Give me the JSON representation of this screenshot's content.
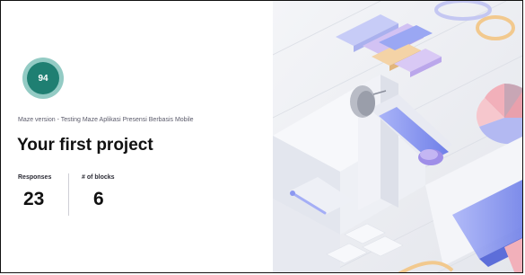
{
  "project": {
    "score": "94",
    "version_text": "Maze version - Testing Maze Aplikasi Presensi Berbasis Mobile",
    "title": "Your first project"
  },
  "stats": [
    {
      "label": "Responses",
      "value": "23"
    },
    {
      "label": "# of blocks",
      "value": "6"
    }
  ],
  "colors": {
    "score_fill": "#1f7f72",
    "score_ring": "#93cbc4",
    "accent_blue": "#8b97f0",
    "accent_pink": "#f0aab4",
    "accent_purple": "#b9a8ee",
    "accent_yellow": "#f2c98e"
  },
  "illustration": {
    "name": "isometric-maze-illustration"
  }
}
